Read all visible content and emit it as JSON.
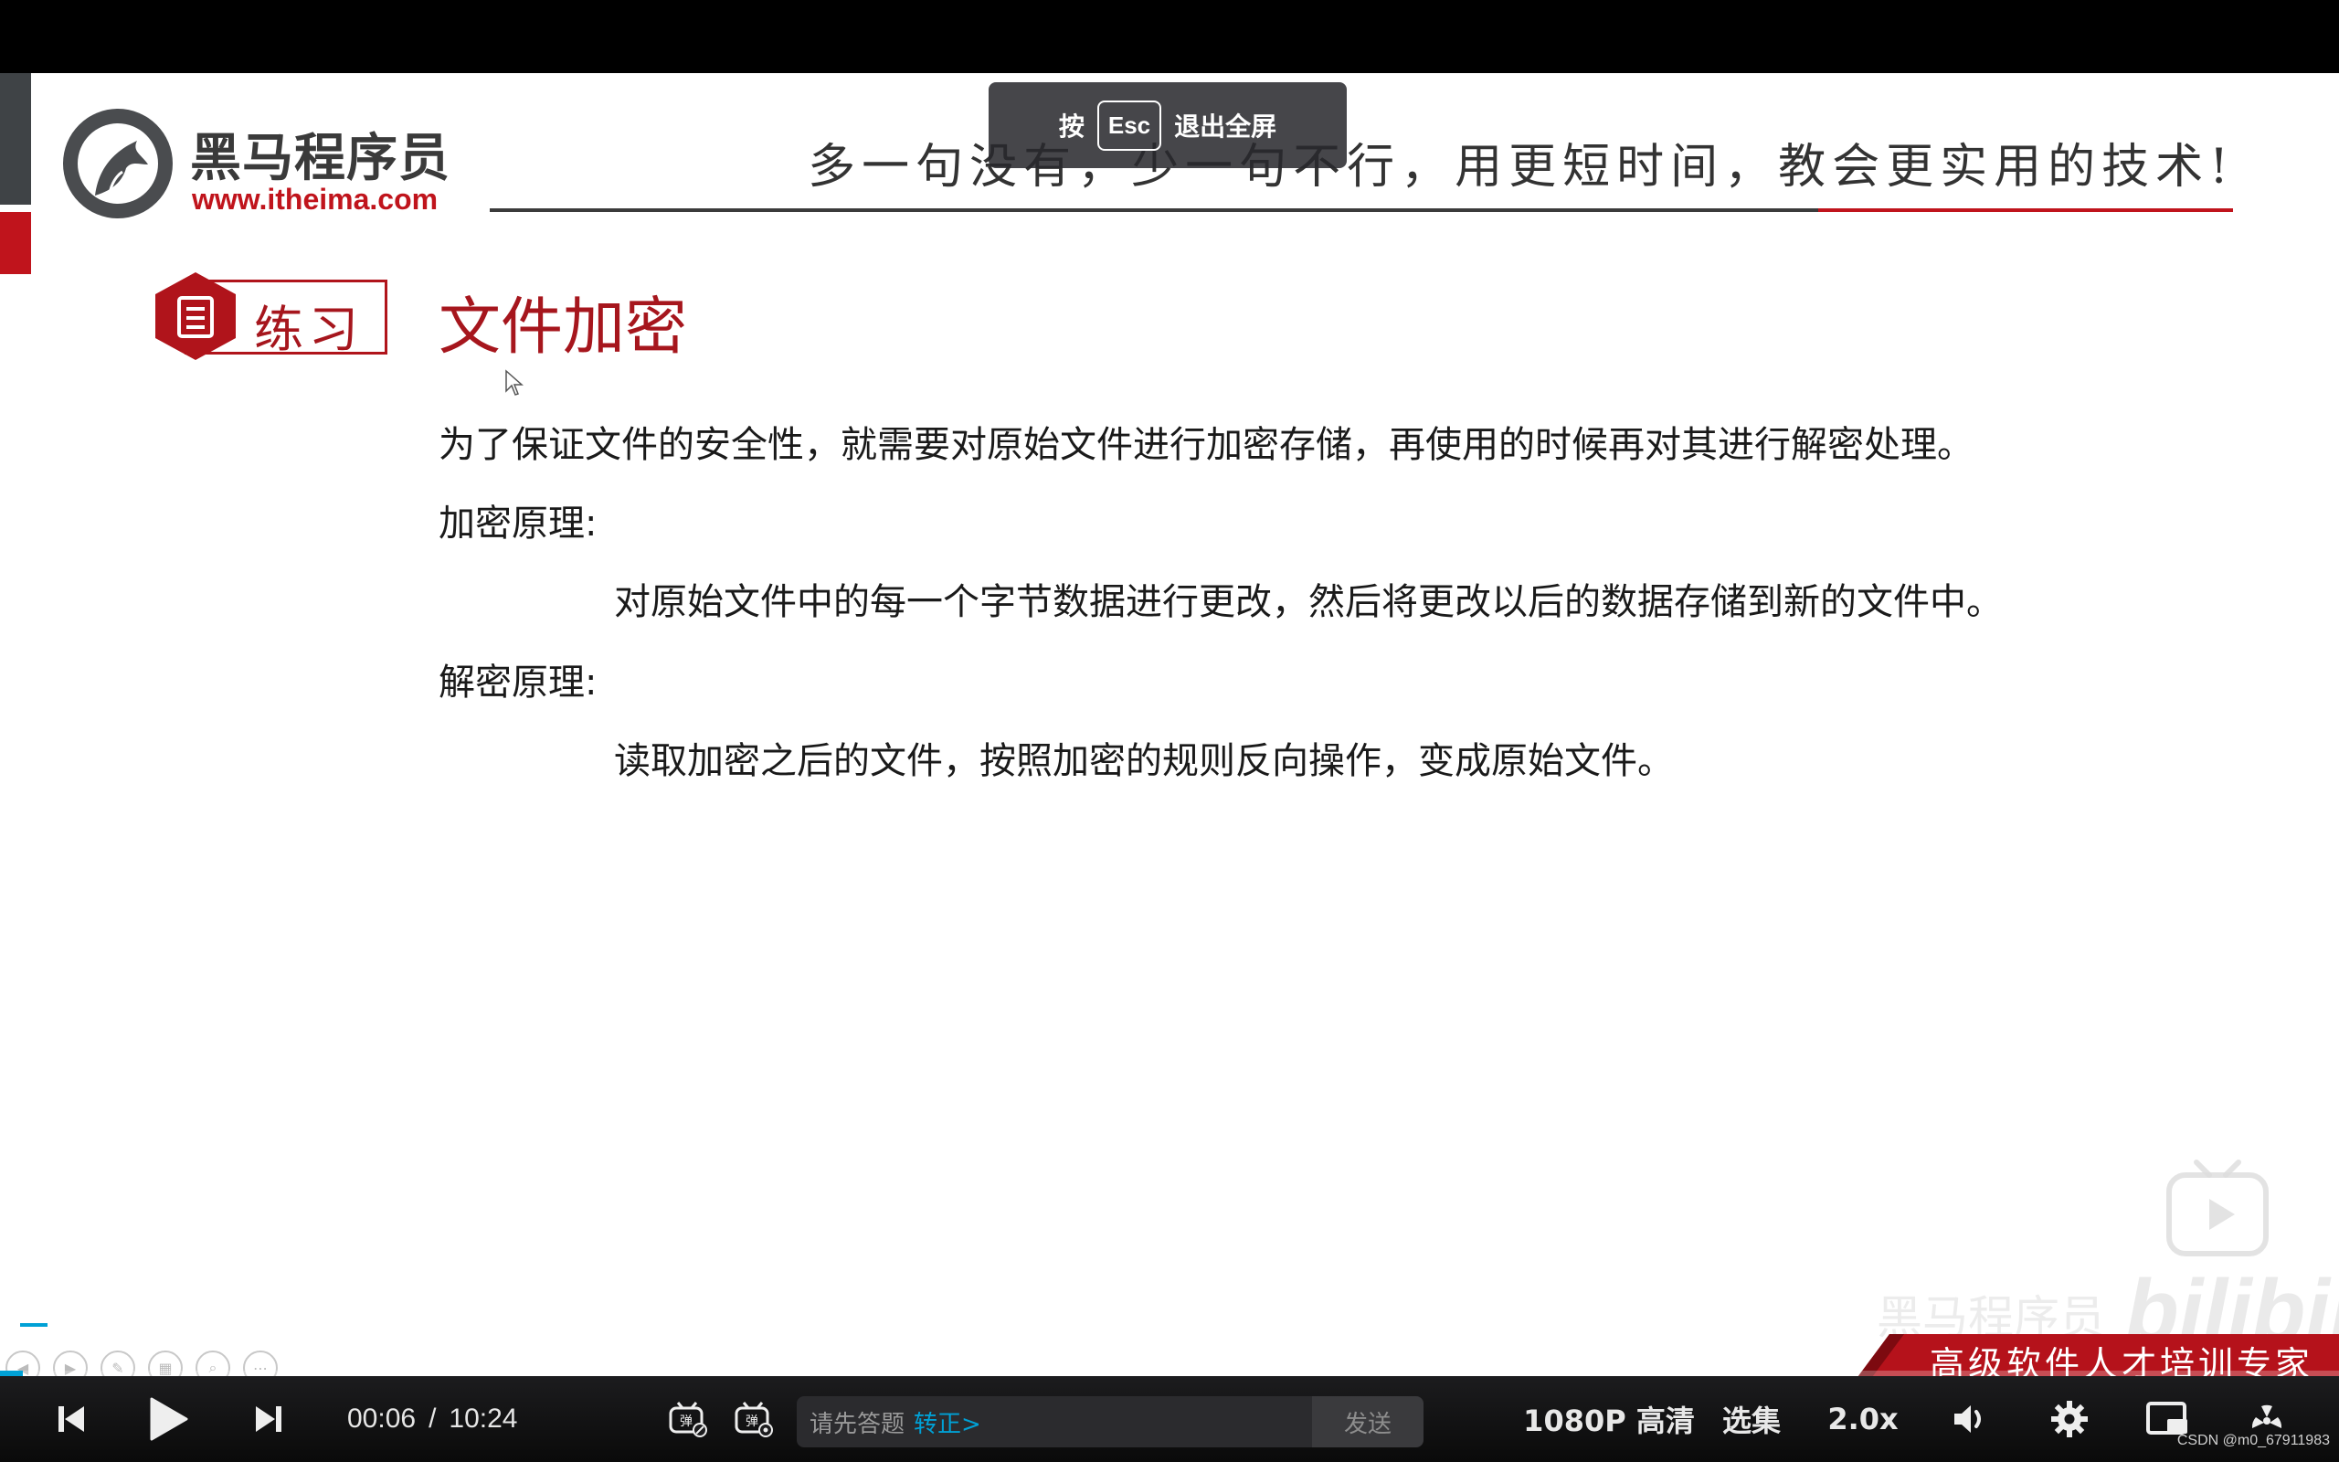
{
  "esc_hint": {
    "press": "按",
    "key": "Esc",
    "action": "退出全屏"
  },
  "logo": {
    "name": "黑马程序员",
    "url": "www.itheima.com"
  },
  "slogan": "多一句没有，少一句不行，用更短时间，教会更实用的技术!",
  "badge": {
    "label": "练习"
  },
  "title": "文件加密",
  "content": {
    "intro": "为了保证文件的安全性，就需要对原始文件进行加密存储，再使用的时候再对其进行解密处理。",
    "encrypt_heading": "加密原理:",
    "encrypt_body": "对原始文件中的每一个字节数据进行更改，然后将更改以后的数据存储到新的文件中。",
    "decrypt_heading": "解密原理:",
    "decrypt_body": "读取加密之后的文件，按照加密的规则反向操作，变成原始文件。"
  },
  "watermark": {
    "brand": "黑马程序员",
    "site": "bilibili"
  },
  "banner": {
    "text": "高级软件人才培训专家"
  },
  "player": {
    "current_time": "00:06",
    "separator": "/",
    "duration": "10:24",
    "danmaku_placeholder": "请先答题",
    "danmaku_link": "转正>",
    "send_label": "发送",
    "quality": "1080P 高清",
    "episodes": "选集",
    "speed": "2.0x",
    "progress": 0.0096
  },
  "credit": "CSDN @m0_67911983",
  "colors": {
    "brand_red": "#c0141c",
    "accent_blue": "#00a1d6"
  }
}
